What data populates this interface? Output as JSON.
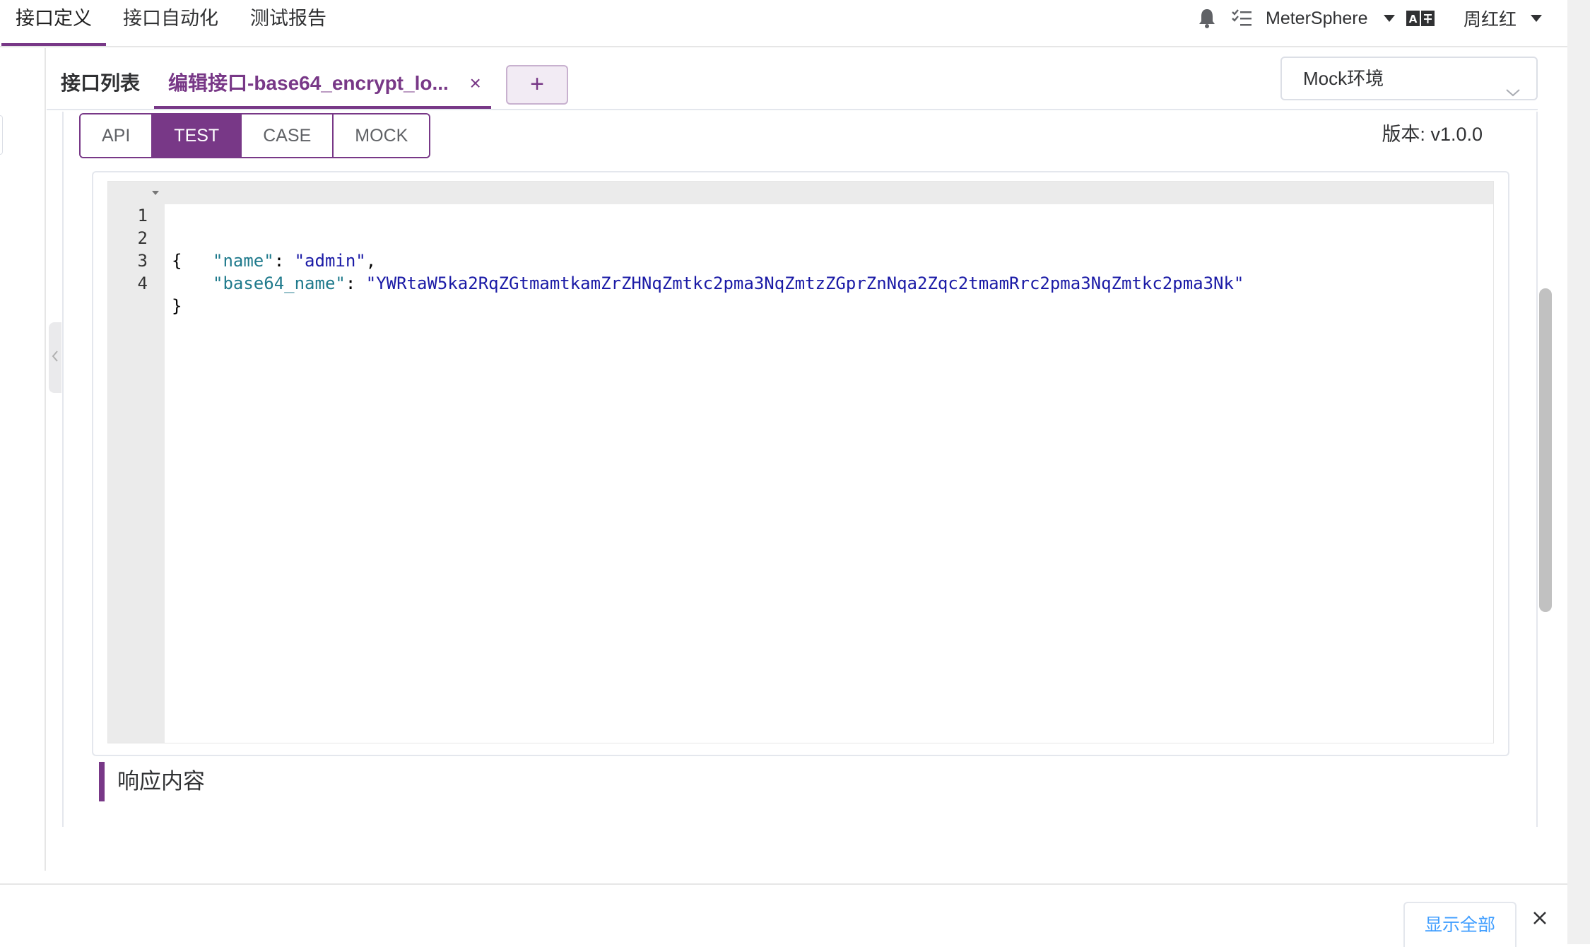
{
  "top_nav": {
    "tabs": [
      "接口定义",
      "接口自动化",
      "测试报告"
    ],
    "project": "MeterSphere",
    "user": "周红红",
    "icons": [
      "bell-icon",
      "task-list-icon",
      "translate-icon"
    ]
  },
  "sub_tabs": {
    "list_label": "接口列表",
    "edit_label": "编辑接口-base64_encrypt_lo...",
    "close_glyph": "×",
    "add_glyph": "+"
  },
  "environment": {
    "selected": "Mock环境"
  },
  "segments": {
    "items": [
      "API",
      "TEST",
      "CASE",
      "MOCK"
    ],
    "active": "TEST"
  },
  "version_label": "版本: v1.0.0",
  "editor": {
    "lines": [
      {
        "num": "1",
        "text": "{"
      },
      {
        "num": "2",
        "key": "\"name\"",
        "sep": ": ",
        "value": "\"admin\"",
        "tail": ","
      },
      {
        "num": "3",
        "key": "\"base64_name\"",
        "sep": ": ",
        "value": "\"YWRtaW5ka2RqZGtmamtkamZrZHNqZmtkc2pma3NqZmtzZGprZnNqa2Zqc2tmamRrc2pma3NqZmtkc2pma3Nk\"",
        "tail": ""
      },
      {
        "num": "4",
        "text": "}"
      }
    ]
  },
  "response_title": "响应内容",
  "bottom_bar": {
    "show_all": "显示全部"
  },
  "colors": {
    "accent": "#783887",
    "link": "#409eff"
  }
}
